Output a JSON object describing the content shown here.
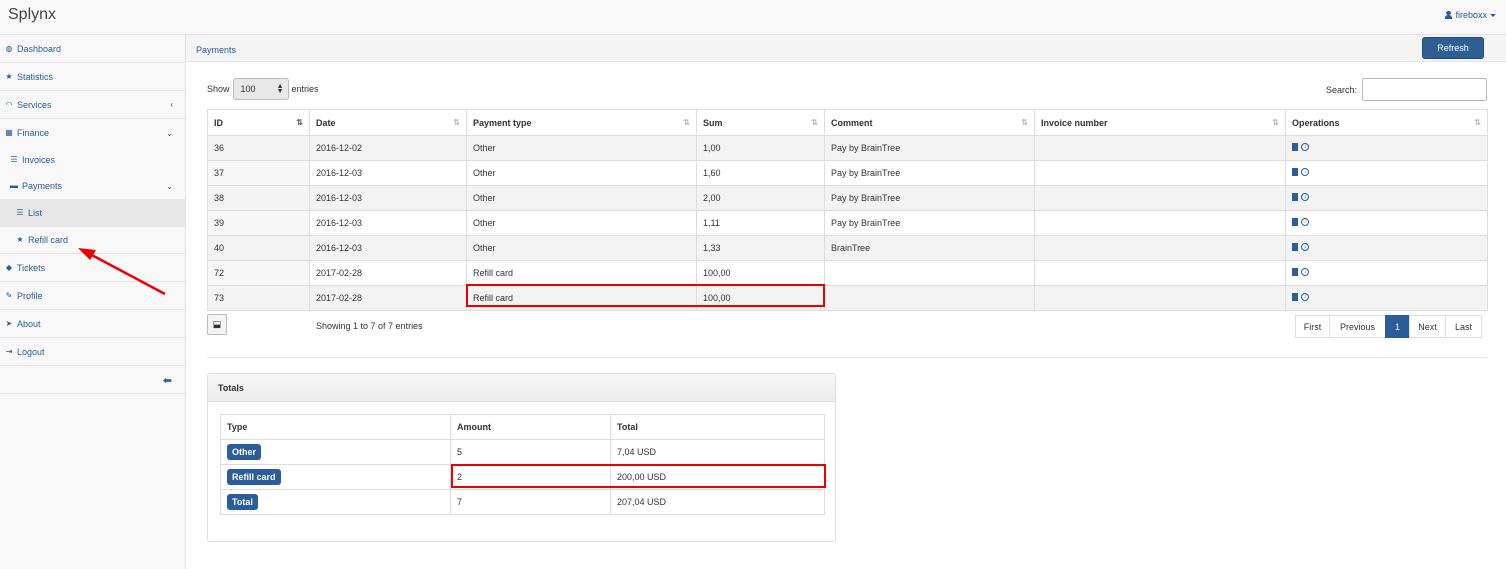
{
  "app": {
    "title": "Splynx",
    "user": "fireboxx"
  },
  "sidebar": {
    "items": [
      {
        "label": "Dashboard",
        "icon": "dashboard-icon"
      },
      {
        "label": "Statistics",
        "icon": "star-icon"
      },
      {
        "label": "Services",
        "icon": "wifi-icon"
      },
      {
        "label": "Finance",
        "icon": "finance-icon"
      },
      {
        "label": "Invoices",
        "icon": "list-icon"
      },
      {
        "label": "Payments",
        "icon": "payments-icon"
      },
      {
        "label": "List",
        "icon": "list-icon"
      },
      {
        "label": "Refill card",
        "icon": "star-icon"
      },
      {
        "label": "Tickets",
        "icon": "tag-icon"
      },
      {
        "label": "Profile",
        "icon": "pencil-icon"
      },
      {
        "label": "About",
        "icon": "rocket-icon"
      },
      {
        "label": "Logout",
        "icon": "logout-icon"
      }
    ]
  },
  "header": {
    "breadcrumb": "Payments",
    "refresh_label": "Refresh"
  },
  "controls": {
    "show_label": "Show",
    "entries_value": "100",
    "entries_label": "entries",
    "search_label": "Search:",
    "search_value": ""
  },
  "table": {
    "columns": [
      "ID",
      "Date",
      "Payment type",
      "Sum",
      "Comment",
      "Invoice number",
      "Operations"
    ],
    "rows": [
      {
        "id": "36",
        "date": "2016-12-02",
        "type": "Other",
        "sum": "1,00",
        "comment": "Pay by BrainTree",
        "invoice": ""
      },
      {
        "id": "37",
        "date": "2016-12-03",
        "type": "Other",
        "sum": "1,60",
        "comment": "Pay by BrainTree",
        "invoice": ""
      },
      {
        "id": "38",
        "date": "2016-12-03",
        "type": "Other",
        "sum": "2,00",
        "comment": "Pay by BrainTree",
        "invoice": ""
      },
      {
        "id": "39",
        "date": "2016-12-03",
        "type": "Other",
        "sum": "1,11",
        "comment": "Pay by BrainTree",
        "invoice": ""
      },
      {
        "id": "40",
        "date": "2016-12-03",
        "type": "Other",
        "sum": "1,33",
        "comment": "BrainTree",
        "invoice": ""
      },
      {
        "id": "72",
        "date": "2017-02-28",
        "type": "Refill card",
        "sum": "100,00",
        "comment": "",
        "invoice": ""
      },
      {
        "id": "73",
        "date": "2017-02-28",
        "type": "Refill card",
        "sum": "100,00",
        "comment": "",
        "invoice": ""
      }
    ],
    "showing": "Showing 1 to 7 of 7 entries"
  },
  "pagination": {
    "first": "First",
    "previous": "Previous",
    "current": "1",
    "next": "Next",
    "last": "Last"
  },
  "totals": {
    "title": "Totals",
    "columns": [
      "Type",
      "Amount",
      "Total"
    ],
    "rows": [
      {
        "type": "Other",
        "amount": "5",
        "total": "7,04 USD"
      },
      {
        "type": "Refill card",
        "amount": "2",
        "total": "200,00 USD"
      },
      {
        "type": "Total",
        "amount": "7",
        "total": "207,04 USD"
      }
    ]
  },
  "colors": {
    "accent": "#2a5d99",
    "highlight": "#ee0000"
  }
}
